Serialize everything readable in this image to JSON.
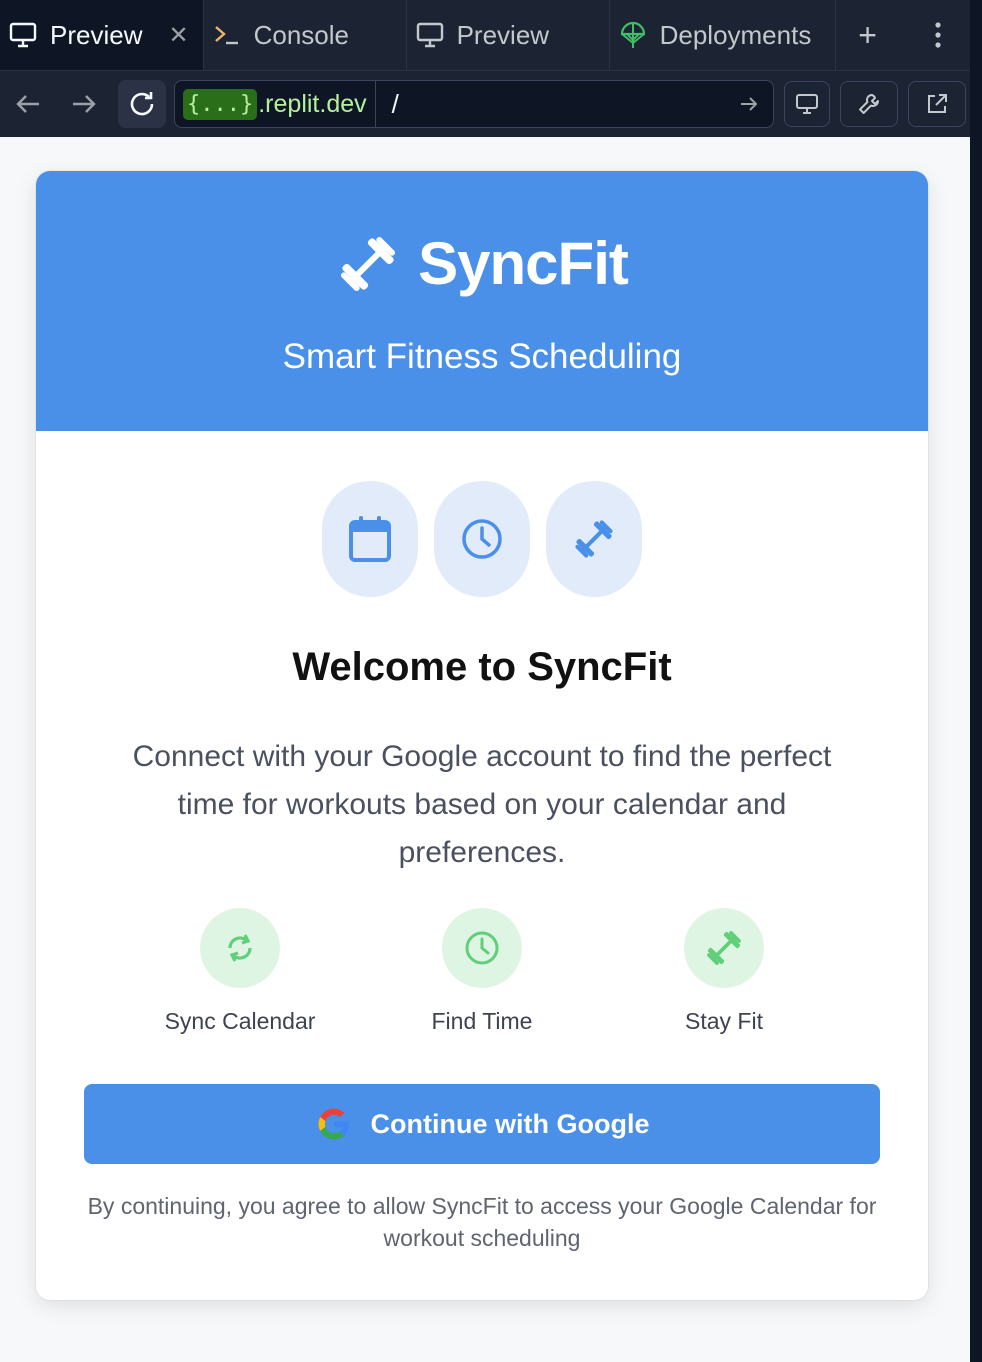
{
  "tabs": [
    {
      "label": "Preview",
      "icon": "monitor-icon",
      "active": true
    },
    {
      "label": "Console",
      "icon": "terminal-icon"
    },
    {
      "label": "Preview",
      "icon": "monitor-icon"
    },
    {
      "label": "Deployments",
      "icon": "deploy-icon"
    }
  ],
  "address": {
    "tag": "{...}",
    "domain": ".replit.dev",
    "path": "/"
  },
  "app": {
    "name": "SyncFit",
    "tagline": "Smart Fitness Scheduling",
    "welcome": "Welcome to SyncFit",
    "intro": "Connect with your Google account to find the perfect time for workouts based on your calendar and preferences.",
    "pills": [
      "calendar-icon",
      "clock-icon",
      "dumbbell-icon"
    ],
    "steps": [
      {
        "label": "Sync Calendar",
        "icon": "sync-icon"
      },
      {
        "label": "Find Time",
        "icon": "clock-icon"
      },
      {
        "label": "Stay Fit",
        "icon": "dumbbell-icon"
      }
    ],
    "cta": "Continue with Google",
    "disclaimer": "By continuing, you agree to allow SyncFit to access your Google Calendar for workout scheduling"
  },
  "colors": {
    "primary": "#4a90e8",
    "pill_bg": "#e1ebf9",
    "step_bg": "#dff5e3",
    "step_icon": "#5fcf7a",
    "ide_bg": "#1c2333",
    "url_green": "#b6f09c"
  }
}
